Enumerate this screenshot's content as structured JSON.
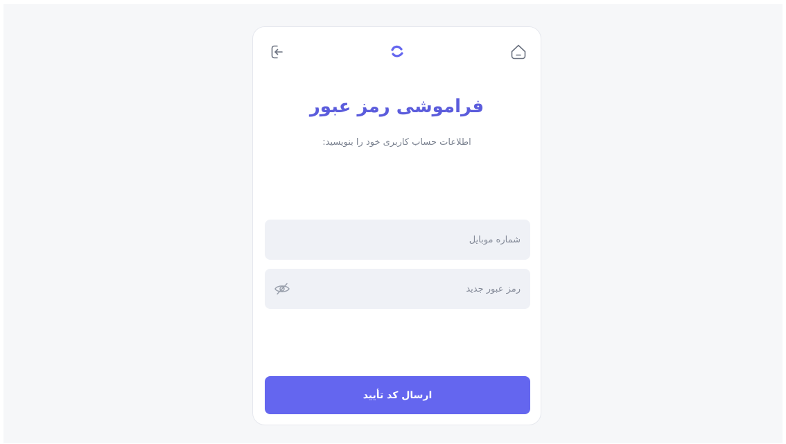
{
  "header": {
    "logout_icon": "logout-arrow-icon",
    "logo_icon": "brand-logo-icon",
    "home_icon": "home-icon"
  },
  "main": {
    "title": "فراموشی رمز عبور",
    "subtitle": "اطلاعات حساب کاربری خود را بنویسید:"
  },
  "form": {
    "mobile": {
      "placeholder": "شماره موبایل",
      "value": ""
    },
    "password": {
      "placeholder": "رمز عبور جدید",
      "value": "",
      "toggle_icon": "eye-off-icon"
    },
    "submit_label": "ارسال کد تأیید"
  },
  "colors": {
    "accent": "#6466ef",
    "title": "#5b5cdc",
    "field_bg": "#eff1f6",
    "page_bg": "#f6f7f9"
  }
}
